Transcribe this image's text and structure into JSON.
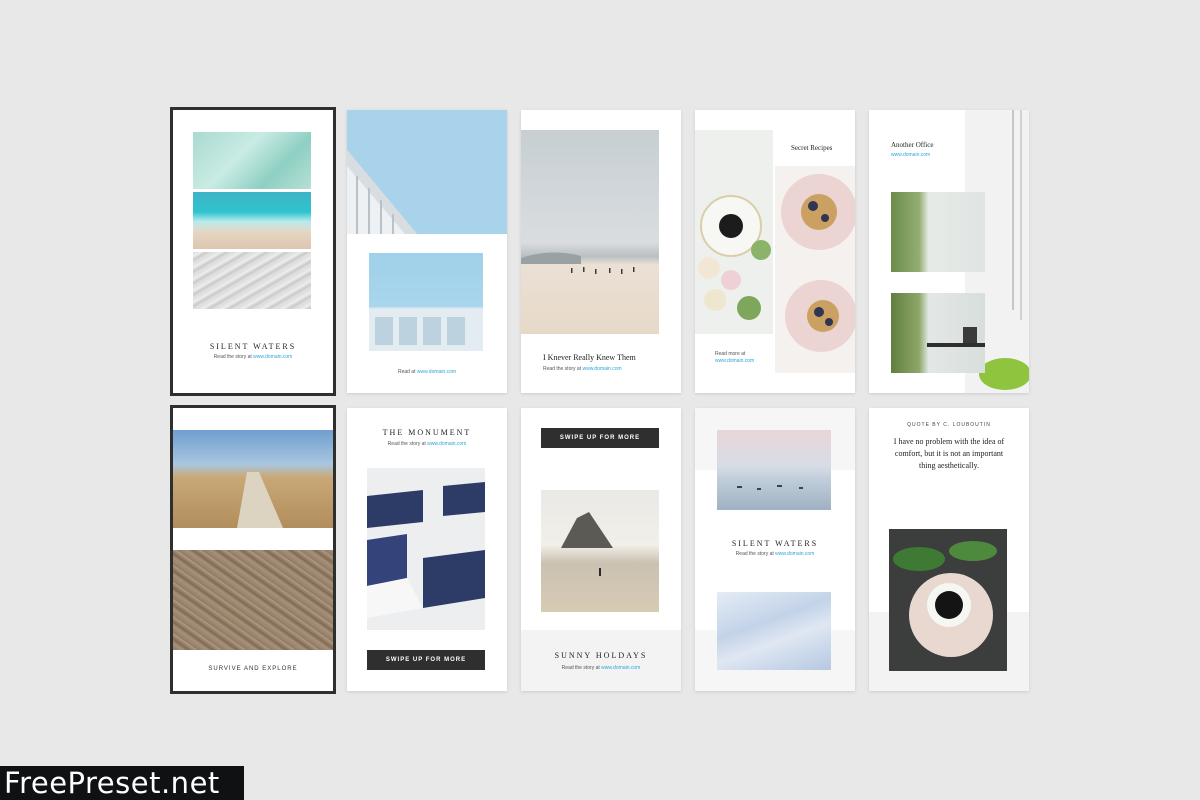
{
  "cards": {
    "silent_waters": {
      "title": "SILENT WATERS",
      "read_prefix": "Read the story at",
      "link": "www.domain.com"
    },
    "architecture": {
      "read_prefix": "Read at",
      "link": "www.domain.com"
    },
    "beach": {
      "title": "I Knever Really Knew Them",
      "read_prefix": "Read the story at",
      "link": "www.domain.com"
    },
    "recipes": {
      "title": "Secret Recipes",
      "read_prefix": "Read more at",
      "link": "www.domain.com"
    },
    "office": {
      "title": "Another Office",
      "link": "www.domain.com"
    },
    "survive": {
      "title": "SURVIVE AND EXPLORE"
    },
    "monument": {
      "title": "THE MONUMENT",
      "read_prefix": "Read the story at",
      "link": "www.domain.com",
      "button": "SWIPE UP FOR MORE"
    },
    "sunny": {
      "button": "SWIPE UP FOR MORE",
      "title": "SUNNY HOLDAYS",
      "read_prefix": "Read the story at",
      "link": "www.domain.com"
    },
    "silent_waters_2": {
      "title": "SILENT WATERS",
      "read_prefix": "Read the story at",
      "link": "www.domain.com"
    },
    "quote": {
      "byline": "QUOTE BY C. LOUBOUTIN",
      "text": "I have no problem with the idea of comfort, but it is not an important thing aesthetically."
    }
  },
  "watermark": {
    "text": "FreePreset.net"
  },
  "colors": {
    "background": "#e8e8e8",
    "link": "#2aa7d8",
    "button": "#2f2f2f"
  }
}
